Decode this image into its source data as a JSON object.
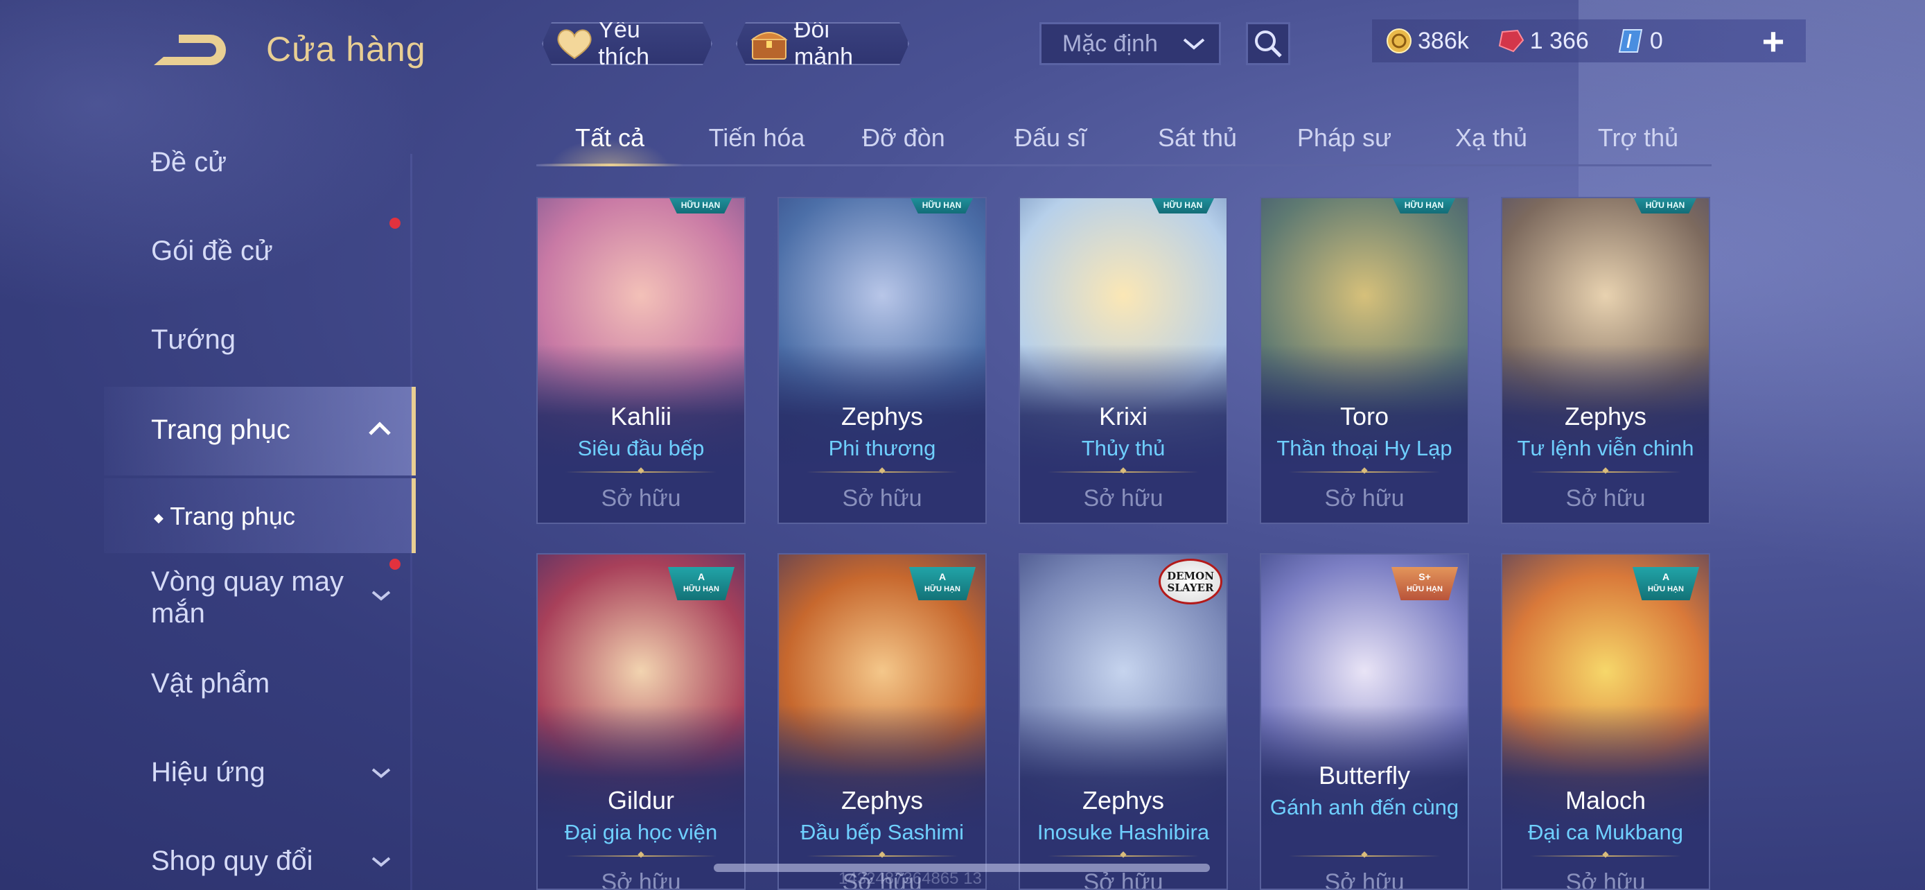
{
  "header": {
    "title": "Cửa hàng",
    "favorites_label": "Yêu thích",
    "swap_label": "Đổi mảnh",
    "sort_value": "Mặc định"
  },
  "currency": {
    "gold": "386k",
    "gems": "1 366",
    "vouchers": "0"
  },
  "sidebar": {
    "items": [
      {
        "label": "Đề cử"
      },
      {
        "label": "Gói đề cử"
      },
      {
        "label": "Tướng"
      },
      {
        "label": "Trang phục"
      },
      {
        "label": "Trang phục"
      },
      {
        "label": "Vòng quay may mắn"
      },
      {
        "label": "Vật phẩm"
      },
      {
        "label": "Hiệu ứng"
      },
      {
        "label": "Shop quy đổi"
      }
    ]
  },
  "tabs": [
    "Tất cả",
    "Tiến hóa",
    "Đỡ đòn",
    "Đấu sĩ",
    "Sát thủ",
    "Pháp sư",
    "Xạ thủ",
    "Trợ thủ"
  ],
  "badges": {
    "limited": "HỮU HẠN",
    "grade_a": "A",
    "grade_splus": "S+",
    "collab": "DEMON SLAYER"
  },
  "cards": [
    {
      "hero": "Kahlii",
      "skin": "Siêu đầu bếp",
      "status": "Sở hữu"
    },
    {
      "hero": "Zephys",
      "skin": "Phi thương",
      "status": "Sở hữu"
    },
    {
      "hero": "Krixi",
      "skin": "Thủy thủ",
      "status": "Sở hữu"
    },
    {
      "hero": "Toro",
      "skin": "Thần thoại Hy Lạp",
      "status": "Sở hữu"
    },
    {
      "hero": "Zephys",
      "skin": "Tư lệnh viễn chinh",
      "status": "Sở hữu"
    },
    {
      "hero": "Gildur",
      "skin": "Đại gia học viện",
      "status": "Sở hữu"
    },
    {
      "hero": "Zephys",
      "skin": "Đầu bếp Sashimi",
      "status": "Sở hữu"
    },
    {
      "hero": "Zephys",
      "skin": "Inosuke Hashibira",
      "status": "Sở hữu"
    },
    {
      "hero": "Butterfly",
      "skin": "Gánh anh đến cùng",
      "status": "Sở hữu"
    },
    {
      "hero": "Maloch",
      "skin": "Đại ca Mukbang",
      "status": "Sở hữu"
    }
  ],
  "watermark": "1432487364865 13",
  "colors": {
    "accent_gold": "#e9cf93",
    "skin_name": "#6fd0ff",
    "badge_teal": "#1f8f9a",
    "notification_red": "#e2323e"
  }
}
